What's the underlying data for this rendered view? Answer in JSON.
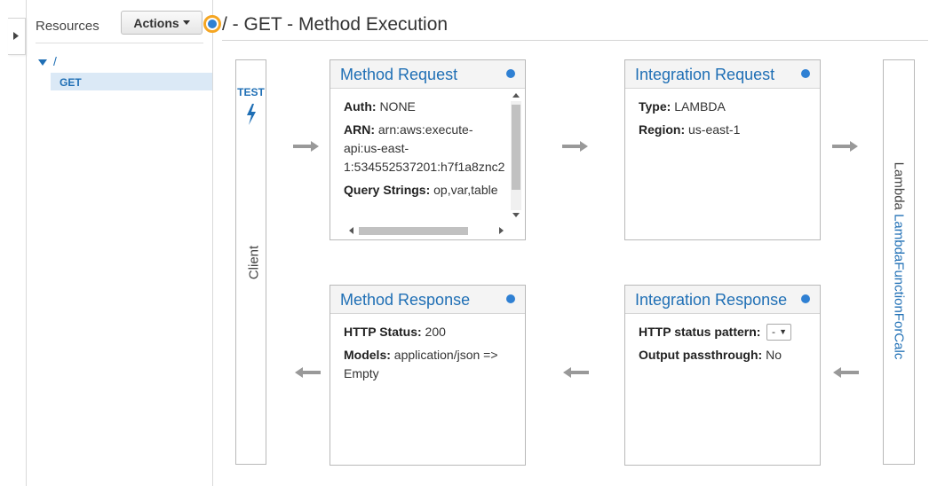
{
  "sidebar": {
    "resources_label": "Resources",
    "actions_label": "Actions",
    "tree": [
      {
        "label": "/",
        "children": [
          {
            "label": "GET",
            "selected": true
          }
        ]
      }
    ]
  },
  "header": {
    "title": "/ - GET - Method Execution"
  },
  "client": {
    "test_label": "TEST",
    "label": "Client"
  },
  "lambda": {
    "prefix": "Lambda",
    "link": "LambdaFunctionForCalc"
  },
  "method_request": {
    "title": "Method Request",
    "auth_key": "Auth:",
    "auth_val": "NONE",
    "arn_key": "ARN:",
    "arn_line1": "arn:aws:execute-",
    "arn_line2": "api:us-east-",
    "arn_line3": "1:534552537201:h7f1a8znc2",
    "qs_key": "Query Strings:",
    "qs_val": "op,var,table"
  },
  "integration_request": {
    "title": "Integration Request",
    "type_key": "Type:",
    "type_val": "LAMBDA",
    "region_key": "Region:",
    "region_val": "us-east-1"
  },
  "method_response": {
    "title": "Method Response",
    "status_key": "HTTP Status:",
    "status_val": "200",
    "models_key": "Models:",
    "models_val": "application/json =>",
    "models_val2": "Empty"
  },
  "integration_response": {
    "title": "Integration Response",
    "pattern_key": "HTTP status pattern:",
    "pattern_val": "-",
    "passthrough_key": "Output passthrough:",
    "passthrough_val": "No"
  },
  "colors": {
    "accent": "#1f6fb5",
    "dot": "#2f80d3",
    "header_dot_ring": "#f5a623"
  }
}
